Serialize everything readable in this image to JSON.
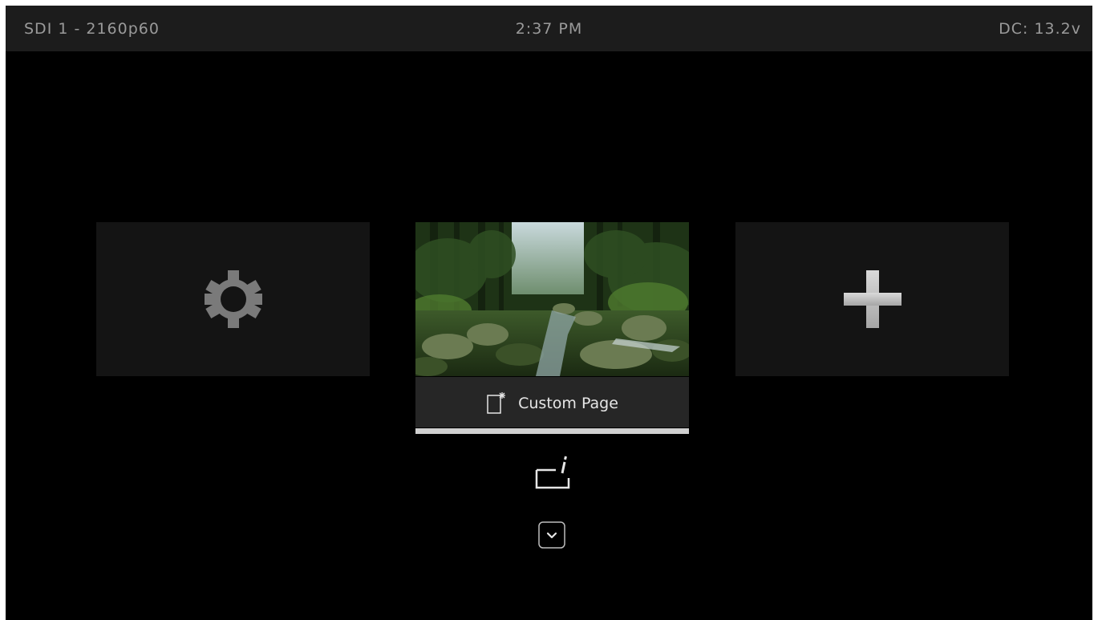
{
  "status_bar": {
    "input": "SDI 1 - 2160p60",
    "clock": "2:37 PM",
    "power": "DC: 13.2v"
  },
  "tiles": [
    {
      "id": "settings",
      "icon": "gear-icon",
      "selected": false
    },
    {
      "id": "custom-page",
      "icon": "page-icon",
      "label": "Custom Page",
      "thumbnail": "forest stream",
      "selected": true
    },
    {
      "id": "add",
      "icon": "plus-icon",
      "selected": false
    }
  ],
  "controls": {
    "edit_icon": "edit-icon",
    "expand_icon": "chevron-down-icon"
  },
  "colors": {
    "background": "#000000",
    "status_bar": "#1c1c1c",
    "tile": "#141414",
    "caption": "#262626",
    "selection": "#d0d0d0"
  }
}
